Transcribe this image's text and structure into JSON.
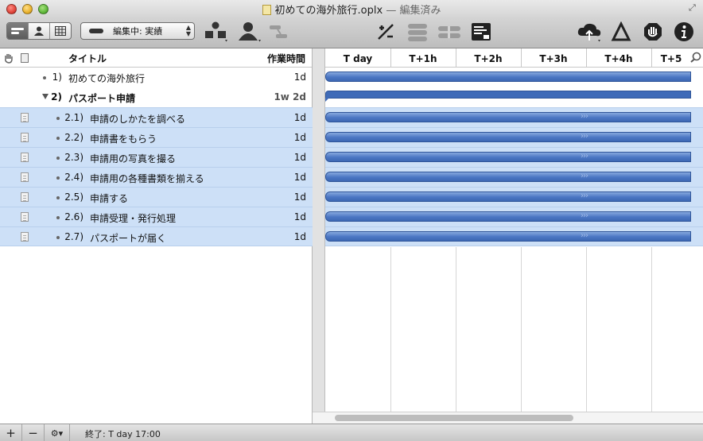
{
  "window": {
    "title": "初めての海外旅行.oplx",
    "edited_suffix": "— 編集済み"
  },
  "toolbar": {
    "edit_mode_popup": "編集中: 実績",
    "icons": [
      "view-mode-outline-icon",
      "resources-icon",
      "table-icon",
      "add-group-icon",
      "add-resource-icon",
      "dependency-icon",
      "percent-complete-icon",
      "milestone-icon",
      "split-icon",
      "report-icon",
      "publish-icon",
      "leveling-icon",
      "violations-icon",
      "inspector-icon"
    ]
  },
  "outline": {
    "col_title": "タイトル",
    "col_effort": "作業時間",
    "rows": [
      {
        "num": "1)",
        "title": "初めての海外旅行",
        "effort": "1d"
      },
      {
        "num": "2)",
        "title": "パスポート申請",
        "effort": "1w 2d"
      },
      {
        "num": "2.1)",
        "title": "申請のしかたを調べる",
        "effort": "1d"
      },
      {
        "num": "2.2)",
        "title": "申請書をもらう",
        "effort": "1d"
      },
      {
        "num": "2.3)",
        "title": "申請用の写真を撮る",
        "effort": "1d"
      },
      {
        "num": "2.4)",
        "title": "申請用の各種書類を揃える",
        "effort": "1d"
      },
      {
        "num": "2.5)",
        "title": "申請する",
        "effort": "1d"
      },
      {
        "num": "2.6)",
        "title": "申請受理・発行処理",
        "effort": "1d"
      },
      {
        "num": "2.7)",
        "title": "パスポートが届く",
        "effort": "1d"
      }
    ]
  },
  "gantt": {
    "columns": [
      "T day",
      "T+1h",
      "T+2h",
      "T+3h",
      "T+4h",
      "T+5"
    ],
    "chevrons": "›››"
  },
  "status": {
    "add_label": "+",
    "remove_label": "−",
    "gear_label": "⚙▾",
    "end_text": "終了: T day 17:00"
  }
}
